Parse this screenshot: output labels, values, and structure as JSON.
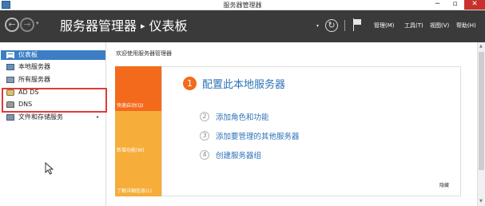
{
  "window": {
    "title": "服务器管理器",
    "minimize_glyph": "−",
    "maximize_glyph": "▫",
    "close_glyph": "✕"
  },
  "header": {
    "back_glyph": "←",
    "forward_glyph": "→",
    "nav_dropdown_glyph": "▾",
    "breadcrumb_root": "服务器管理器",
    "breadcrumb_separator": "▸",
    "breadcrumb_current": "仪表板",
    "refresh_dropdown_glyph": "▾",
    "refresh_glyph": "↻",
    "menu": {
      "manage": "管理(M)",
      "tools": "工具(T)",
      "view": "视图(V)",
      "help": "帮助(H)"
    }
  },
  "sidebar": {
    "items": [
      {
        "label": "仪表板",
        "icon": "dashboard-icon",
        "selected": true
      },
      {
        "label": "本地服务器",
        "icon": "local-server-icon"
      },
      {
        "label": "所有服务器",
        "icon": "all-servers-icon"
      },
      {
        "label": "AD DS",
        "icon": "ad-ds-icon"
      },
      {
        "label": "DNS",
        "icon": "dns-icon"
      },
      {
        "label": "文件和存储服务",
        "icon": "file-storage-icon",
        "expandable": true,
        "arrow": "▸"
      }
    ]
  },
  "main": {
    "welcome_title": "欢迎使用服务器管理器",
    "tiles": {
      "quick_start": "快速启动(Q)",
      "whats_new": "新增功能(W)",
      "learn_more": "了解详细信息(L)"
    },
    "steps": [
      {
        "number": "1",
        "label": "配置此本地服务器"
      },
      {
        "number": "2",
        "label": "添加角色和功能"
      },
      {
        "number": "3",
        "label": "添加要管理的其他服务器"
      },
      {
        "number": "4",
        "label": "创建服务器组"
      }
    ],
    "hide_label": "隐藏"
  },
  "scrollbar": {
    "up_glyph": "▲",
    "down_glyph": "▼"
  },
  "colors": {
    "header_bg": "#3a3a3a",
    "accent_orange": "#f36a1c",
    "tile_amber": "#f6ad3a",
    "link_blue": "#2b72b7",
    "selected_blue": "#3b7ec4",
    "annotation_red": "#e03a3a",
    "close_red": "#c7302c"
  }
}
